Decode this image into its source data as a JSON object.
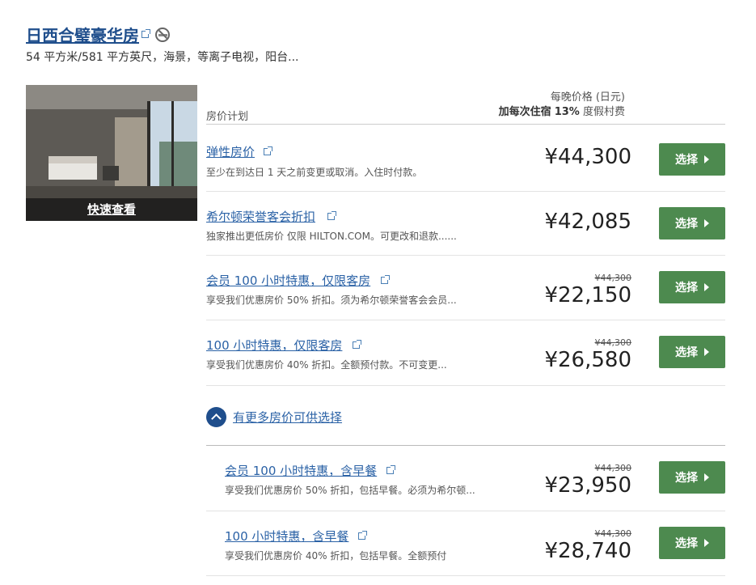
{
  "room": {
    "title": "日西合璧豪华房",
    "description": "54 平方米/581 平方英尺，海景，等离子电视，阳台...",
    "quick_view_label": "快速查看"
  },
  "table_header": {
    "plan_label": "房价计划",
    "price_label": "每晚价格 (日元)",
    "fee_prefix": "加每次住宿",
    "fee_pct": "13%",
    "fee_suffix": "度假村费"
  },
  "rates": [
    {
      "name": "弹性房价",
      "sub": "至少在到达日 1 天之前变更或取消。入住时付款。",
      "old_price": "",
      "price": "¥44,300",
      "button": "选择"
    },
    {
      "name": "希尔顿荣誉客会折扣",
      "sub": "独家推出更低房价 仅限 HILTON.COM。可更改和退款......",
      "old_price": "",
      "price": "¥42,085",
      "button": "选择"
    },
    {
      "name": "会员 100 小时特惠，仅限客房",
      "sub": "享受我们优惠房价 50% 折扣。须为希尔顿荣誉客会会员...",
      "old_price": "¥44,300",
      "price": "¥22,150",
      "button": "选择"
    },
    {
      "name": "100 小时特惠，仅限客房",
      "sub": "享受我们优惠房价 40% 折扣。全额预付款。不可变更...",
      "old_price": "¥44,300",
      "price": "¥26,580",
      "button": "选择"
    }
  ],
  "more_rates_label": "有更多房价可供选择",
  "more_rates": [
    {
      "name": "会员 100 小时特惠，含早餐",
      "sub": "享受我们优惠房价 50% 折扣，包括早餐。必须为希尔顿...",
      "old_price": "¥44,300",
      "price": "¥23,950",
      "button": "选择"
    },
    {
      "name": "100 小时特惠，含早餐",
      "sub": "享受我们优惠房价 40% 折扣，包括早餐。全额预付",
      "old_price": "¥44,300",
      "price": "¥28,740",
      "button": "选择"
    }
  ],
  "colors": {
    "link": "#2b62a6",
    "title": "#1f4e8c",
    "button": "#4d8a4f"
  }
}
